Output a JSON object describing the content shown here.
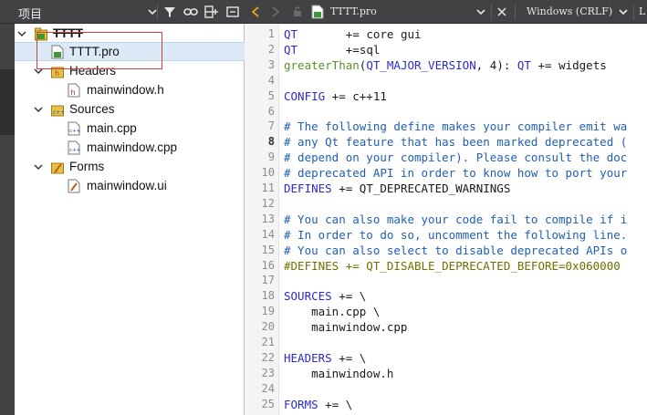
{
  "left_toolbar": {
    "title": "项目"
  },
  "editor_toolbar": {
    "file_name": "TTTT.pro",
    "line_ending": "Windows (CRLF)",
    "right_cut": "L"
  },
  "tree": {
    "project": "TTTT",
    "items": [
      {
        "label": "TTTT.pro",
        "type": "pro"
      },
      {
        "label": "Headers",
        "type": "folder-h"
      },
      {
        "label": "mainwindow.h",
        "type": "h"
      },
      {
        "label": "Sources",
        "type": "folder-cpp"
      },
      {
        "label": "main.cpp",
        "type": "cpp"
      },
      {
        "label": "mainwindow.cpp",
        "type": "cpp"
      },
      {
        "label": "Forms",
        "type": "folder-ui"
      },
      {
        "label": "mainwindow.ui",
        "type": "ui"
      }
    ]
  },
  "editor": {
    "current_line": 8,
    "lines": [
      {
        "n": "1",
        "parts": [
          [
            "c-blue",
            "QT"
          ],
          [
            "c-black",
            "       += core gui"
          ]
        ]
      },
      {
        "n": "2",
        "parts": [
          [
            "c-blue",
            "QT"
          ],
          [
            "c-black",
            "       +=sql"
          ]
        ]
      },
      {
        "n": "3",
        "parts": [
          [
            "c-green",
            "greaterThan"
          ],
          [
            "c-black",
            "("
          ],
          [
            "c-blue",
            "QT_MAJOR_VERSION"
          ],
          [
            "c-black",
            ", 4): "
          ],
          [
            "c-blue",
            "QT"
          ],
          [
            "c-black",
            " += widgets"
          ]
        ]
      },
      {
        "n": "4",
        "parts": []
      },
      {
        "n": "5",
        "parts": [
          [
            "c-blue",
            "CONFIG"
          ],
          [
            "c-black",
            " += c++11"
          ]
        ]
      },
      {
        "n": "6",
        "parts": []
      },
      {
        "n": "7",
        "parts": [
          [
            "c-comment",
            "# The following define makes your compiler emit wa"
          ]
        ]
      },
      {
        "n": "8",
        "parts": [
          [
            "c-comment",
            "# any Qt feature that has been marked deprecated ("
          ]
        ]
      },
      {
        "n": "9",
        "parts": [
          [
            "c-comment",
            "# depend on your compiler). Please consult the doc"
          ]
        ]
      },
      {
        "n": "10",
        "parts": [
          [
            "c-comment",
            "# deprecated API in order to know how to port your"
          ]
        ]
      },
      {
        "n": "11",
        "parts": [
          [
            "c-blue",
            "DEFINES"
          ],
          [
            "c-black",
            " += QT_DEPRECATED_WARNINGS"
          ]
        ]
      },
      {
        "n": "12",
        "parts": []
      },
      {
        "n": "13",
        "parts": [
          [
            "c-comment",
            "# You can also make your code fail to compile if i"
          ]
        ]
      },
      {
        "n": "14",
        "parts": [
          [
            "c-comment",
            "# In order to do so, uncomment the following line."
          ]
        ]
      },
      {
        "n": "15",
        "parts": [
          [
            "c-comment",
            "# You can also select to disable deprecated APIs o"
          ]
        ]
      },
      {
        "n": "16",
        "parts": [
          [
            "c-olive",
            "#DEFINES += QT_DISABLE_DEPRECATED_BEFORE=0x060000"
          ]
        ]
      },
      {
        "n": "17",
        "parts": []
      },
      {
        "n": "18",
        "parts": [
          [
            "c-blue",
            "SOURCES"
          ],
          [
            "c-black",
            " += \\"
          ]
        ]
      },
      {
        "n": "19",
        "parts": [
          [
            "c-black",
            "    main.cpp \\"
          ]
        ]
      },
      {
        "n": "20",
        "parts": [
          [
            "c-black",
            "    mainwindow.cpp"
          ]
        ]
      },
      {
        "n": "21",
        "parts": []
      },
      {
        "n": "22",
        "parts": [
          [
            "c-blue",
            "HEADERS"
          ],
          [
            "c-black",
            " += \\"
          ]
        ]
      },
      {
        "n": "23",
        "parts": [
          [
            "c-black",
            "    mainwindow.h"
          ]
        ]
      },
      {
        "n": "24",
        "parts": []
      },
      {
        "n": "25",
        "parts": [
          [
            "c-blue",
            "FORMS"
          ],
          [
            "c-black",
            " += \\"
          ]
        ]
      }
    ]
  },
  "colors": {
    "toolbar_bg": "#404244",
    "selection_bg": "#dceaf8",
    "annotation_red": "#d04040",
    "keyword_blue": "#2b2bd0",
    "comment_blue": "#1f5fb3",
    "function_green": "#5a8f2a"
  },
  "icons": [
    "filter-icon",
    "link-icon",
    "split-add-icon",
    "close-panel-icon",
    "back-arrow-icon",
    "forward-arrow-icon",
    "lock-icon",
    "pro-file-icon",
    "close-icon"
  ]
}
